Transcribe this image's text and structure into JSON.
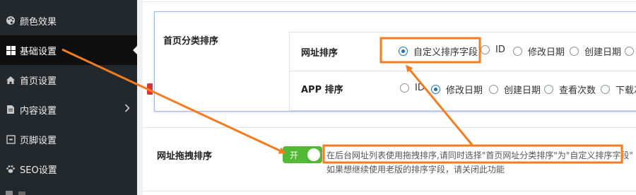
{
  "sidebar": {
    "items": [
      {
        "label": "颜色效果",
        "icon": "palette-icon"
      },
      {
        "label": "基础设置",
        "icon": "grid-icon"
      },
      {
        "label": "首页设置",
        "icon": "home-icon"
      },
      {
        "label": "内容设置",
        "icon": "document-icon"
      },
      {
        "label": "页脚设置",
        "icon": "footer-icon"
      },
      {
        "label": "SEO设置",
        "icon": "paw-icon"
      }
    ]
  },
  "card": {
    "title": "首页分类排序",
    "rows": [
      {
        "label": "网址排序",
        "options": [
          "自定义排序字段",
          "ID",
          "修改日期",
          "创建日期",
          "点"
        ],
        "selected": "自定义排序字段"
      },
      {
        "label": "APP 排序",
        "options": [
          "ID",
          "修改日期",
          "创建日期",
          "查看次数",
          "下载次"
        ],
        "selected": "修改日期"
      }
    ]
  },
  "setting": {
    "label": "网址拖拽排序",
    "toggle_label": "开",
    "toggle_on": true,
    "desc_line1": "在后台网址列表使用拖拽排序,请同时选择\"首页网址分类排序\"为\"自定义排序字段\"",
    "desc_line2": "如果想继续使用老版的排序字段，请关闭此功能"
  },
  "colors": {
    "sidebar_bg": "#23282d",
    "active_bg": "#0f0f10",
    "toggle_on": "#52b934",
    "accent": "#2271b1",
    "annotation": "#f57c1f"
  }
}
